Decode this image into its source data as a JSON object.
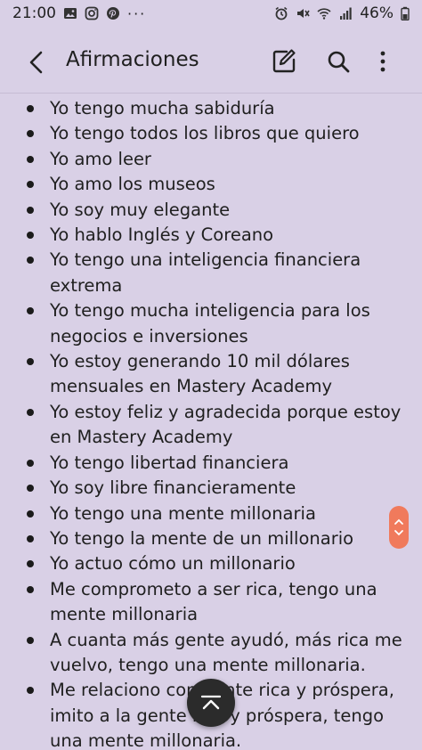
{
  "status_bar": {
    "time": "21:00",
    "overflow": "···",
    "battery": "46%",
    "icons": [
      "gallery-icon",
      "instagram-icon",
      "pinterest-icon",
      "alarm-icon",
      "mute-icon",
      "wifi-icon",
      "signal-icon",
      "battery-icon"
    ]
  },
  "app_bar": {
    "title": "Afirmaciones",
    "icons": [
      "back-icon",
      "edit-icon",
      "search-icon",
      "more-vert-icon"
    ]
  },
  "note": {
    "items": [
      "Yo tengo mucha sabiduría",
      "Yo tengo todos los libros que quiero",
      "Yo amo leer",
      "Yo amo los museos",
      "Yo soy muy elegante",
      "Yo hablo Inglés y Coreano",
      "Yo tengo una inteligencia financiera extrema",
      "Yo tengo mucha inteligencia para los negocios e inversiones",
      "Yo estoy generando 10 mil dólares mensuales en Mastery Academy",
      "Yo estoy feliz y agradecida porque estoy en Mastery Academy",
      "Yo tengo libertad financiera",
      "Yo soy libre financieramente",
      "Yo tengo una mente millonaria",
      "Yo tengo la mente de un millonario",
      "Yo actuo cómo un millonario",
      "Me comprometo a ser rica, tengo una mente millonaria",
      "A cuanta más gente ayudó, más rica me vuelvo, tengo una mente millonaria.",
      "Me relaciono con gente rica y próspera, imito a la gente rica y próspera, tengo una mente millonaria."
    ]
  },
  "colors": {
    "background": "#d9d0e6",
    "scroll_accent": "#f07a5c",
    "fab": "#2b2b2b"
  }
}
